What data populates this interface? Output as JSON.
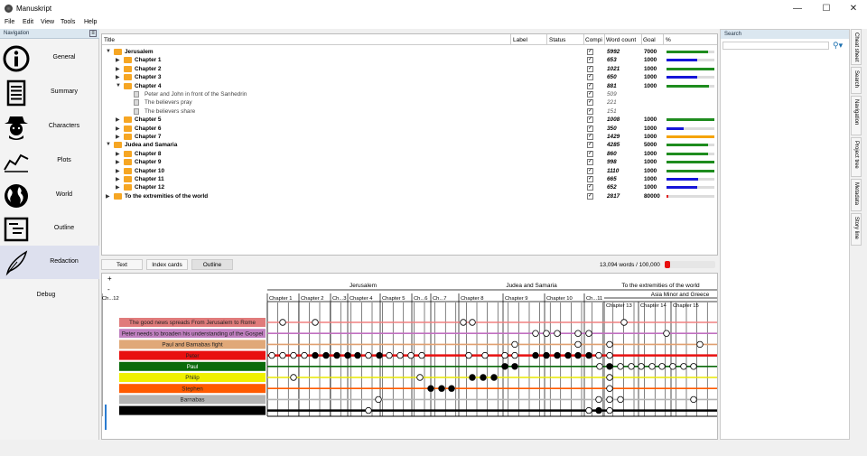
{
  "window": {
    "title": "Manuskript",
    "min": "—",
    "max": "☐",
    "close": "✕"
  },
  "menu": [
    "File",
    "Edit",
    "View",
    "Tools",
    "Help"
  ],
  "navigation": {
    "header": "Navigation",
    "items": [
      {
        "label": "General",
        "icon": "info-icon"
      },
      {
        "label": "Summary",
        "icon": "summary-icon"
      },
      {
        "label": "Characters",
        "icon": "characters-icon"
      },
      {
        "label": "Plots",
        "icon": "plots-icon"
      },
      {
        "label": "World",
        "icon": "world-icon"
      },
      {
        "label": "Outline",
        "icon": "outline-icon"
      },
      {
        "label": "Redaction",
        "icon": "quill-icon",
        "selected": true
      },
      {
        "label": "Debug",
        "icon": ""
      }
    ]
  },
  "outline": {
    "columns": [
      "Title",
      "Label",
      "Status",
      "Compi",
      "Word count",
      "Goal",
      "%"
    ],
    "rows": [
      {
        "title": "Jerusalem",
        "type": "folder",
        "level": 0,
        "expanded": true,
        "wc": "5992",
        "goal": "7000",
        "pct": 0.86,
        "color": "#1e8c1e",
        "bold": true
      },
      {
        "title": "Chapter 1",
        "type": "folder",
        "level": 1,
        "expanded": false,
        "wc": "653",
        "goal": "1000",
        "pct": 0.65,
        "color": "#1515d8",
        "bold": true
      },
      {
        "title": "Chapter 2",
        "type": "folder",
        "level": 1,
        "expanded": false,
        "wc": "1021",
        "goal": "1000",
        "pct": 1.0,
        "color": "#1e8c1e",
        "bold": true
      },
      {
        "title": "Chapter 3",
        "type": "folder",
        "level": 1,
        "expanded": false,
        "wc": "650",
        "goal": "1000",
        "pct": 0.65,
        "color": "#1515d8",
        "bold": true
      },
      {
        "title": "Chapter 4",
        "type": "folder",
        "level": 1,
        "expanded": true,
        "wc": "881",
        "goal": "1000",
        "pct": 0.88,
        "color": "#1e8c1e",
        "bold": true
      },
      {
        "title": "Peter and John in front of the Sanhedrin",
        "type": "doc",
        "level": 2,
        "wc": "509",
        "goal": "",
        "pct": null,
        "bold": false
      },
      {
        "title": "The believers pray",
        "type": "doc",
        "level": 2,
        "wc": "221",
        "goal": "",
        "pct": null,
        "bold": false
      },
      {
        "title": "The believers share",
        "type": "doc",
        "level": 2,
        "wc": "151",
        "goal": "",
        "pct": null,
        "bold": false
      },
      {
        "title": "Chapter 5",
        "type": "folder",
        "level": 1,
        "expanded": false,
        "wc": "1008",
        "goal": "1000",
        "pct": 1.0,
        "color": "#1e8c1e",
        "bold": true
      },
      {
        "title": "Chapter 6",
        "type": "folder",
        "level": 1,
        "expanded": false,
        "wc": "350",
        "goal": "1000",
        "pct": 0.35,
        "color": "#1515d8",
        "bold": true
      },
      {
        "title": "Chapter 7",
        "type": "folder",
        "level": 1,
        "expanded": false,
        "wc": "1429",
        "goal": "1000",
        "pct": 1.0,
        "color": "#f5a300",
        "bold": true
      },
      {
        "title": "Judea and Samaria",
        "type": "folder",
        "level": 0,
        "expanded": true,
        "wc": "4285",
        "goal": "5000",
        "pct": 0.86,
        "color": "#1e8c1e",
        "bold": true
      },
      {
        "title": "Chapter 8",
        "type": "folder",
        "level": 1,
        "expanded": false,
        "wc": "860",
        "goal": "1000",
        "pct": 0.86,
        "color": "#1e8c1e",
        "bold": true
      },
      {
        "title": "Chapter 9",
        "type": "folder",
        "level": 1,
        "expanded": false,
        "wc": "998",
        "goal": "1000",
        "pct": 1.0,
        "color": "#1e8c1e",
        "bold": true
      },
      {
        "title": "Chapter 10",
        "type": "folder",
        "level": 1,
        "expanded": false,
        "wc": "1110",
        "goal": "1000",
        "pct": 1.0,
        "color": "#1e8c1e",
        "bold": true
      },
      {
        "title": "Chapter 11",
        "type": "folder",
        "level": 1,
        "expanded": false,
        "wc": "665",
        "goal": "1000",
        "pct": 0.66,
        "color": "#1515d8",
        "bold": true
      },
      {
        "title": "Chapter 12",
        "type": "folder",
        "level": 1,
        "expanded": false,
        "wc": "652",
        "goal": "1000",
        "pct": 0.65,
        "color": "#1515d8",
        "bold": true
      },
      {
        "title": "To the extremities of the world",
        "type": "folder",
        "level": 0,
        "expanded": false,
        "wc": "2817",
        "goal": "80000",
        "pct": 0.035,
        "color": "#e02020",
        "bold": true
      }
    ]
  },
  "view_tabs": [
    "Text",
    "Index cards",
    "Outline"
  ],
  "total": "13,094 words / 100,000",
  "storyline": {
    "parts": [
      {
        "name": "Jerusalem",
        "chapters": [
          "Chapter 1",
          "Chapter 2",
          "Ch...3",
          "Chapter 4",
          "Chapter 5",
          "Ch...6",
          "Ch...7"
        ]
      },
      {
        "name": "Judea and Samaria",
        "chapters": [
          "Chapter 8",
          "Chapter 9",
          "Chapter 10",
          "Ch...11",
          "Ch...12"
        ]
      },
      {
        "name": "To the extremities of the world",
        "sub": "Asia Minor and Greece",
        "chapters": [
          "Chapter 13",
          "Chapter 14",
          "Chapter 15"
        ]
      }
    ],
    "plots": [
      {
        "name": "The good news spreads From Jerusalem to Rome",
        "color": "#e07b7b",
        "line": "#f08080"
      },
      {
        "name": "Peter needs to broaden his understanding of the Gospel",
        "color": "#c080c0",
        "line": "#c070c0"
      },
      {
        "name": "Paul and Barnabas fight",
        "color": "#e0a878",
        "line": "#e0a070"
      },
      {
        "name": "Peter",
        "color": "#e81010",
        "line": "#e81010"
      },
      {
        "name": "Paul",
        "color": "#0a6a0a",
        "line": "#0a6a0a"
      },
      {
        "name": "Philip",
        "color": "#f0f000",
        "line": "#e8e800"
      },
      {
        "name": "Stephen",
        "color": "#ff5a00",
        "line": "#ff5a00"
      },
      {
        "name": "Barnabas",
        "color": "#b4b4b4",
        "line": "#b4b4b4"
      },
      {
        "name": "",
        "color": "#000000",
        "line": "#000000"
      }
    ]
  },
  "search": {
    "header": "Search",
    "placeholder": ""
  },
  "side_tabs": [
    "Cheat sheet",
    "Search",
    "Navigation",
    "Project tree",
    "Metadata",
    "Story line"
  ]
}
